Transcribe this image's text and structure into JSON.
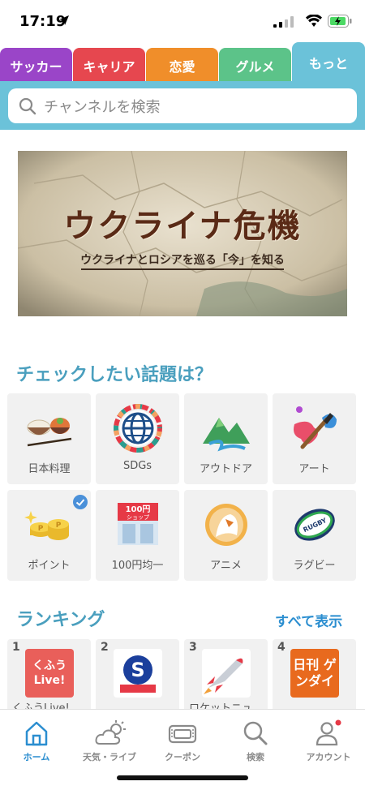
{
  "status_bar": {
    "time": "17:19"
  },
  "tabs": [
    {
      "label": "サッカー",
      "color": "#9a45c8"
    },
    {
      "label": "キャリア",
      "color": "#e6474f"
    },
    {
      "label": "恋愛",
      "color": "#f08e2a"
    },
    {
      "label": "グルメ",
      "color": "#5cc389"
    },
    {
      "label": "もっと",
      "color": "#6bc2d9"
    }
  ],
  "search": {
    "placeholder": "チャンネルを検索"
  },
  "banner": {
    "title": "ウクライナ危機",
    "subtitle": "ウクライナとロシアを巡る「今」を知る"
  },
  "topics": {
    "heading": "チェックしたい話題は？",
    "items": [
      {
        "label": "日本料理",
        "icon": "japanese-food-icon"
      },
      {
        "label": "SDGs",
        "icon": "sdgs-globe-icon"
      },
      {
        "label": "アウトドア",
        "icon": "mountain-icon"
      },
      {
        "label": "アート",
        "icon": "paint-brush-icon"
      },
      {
        "label": "ポイント",
        "icon": "coins-icon",
        "checked": true
      },
      {
        "label": "100円均一",
        "icon": "hundred-yen-shop-icon"
      },
      {
        "label": "アニメ",
        "icon": "anime-icon"
      },
      {
        "label": "ラグビー",
        "icon": "rugby-ball-icon"
      }
    ]
  },
  "ranking": {
    "heading": "ランキング",
    "see_all": "すべて表示",
    "items": [
      {
        "rank": "1",
        "name": "くふうLive!",
        "logo_text": "くふう Live!"
      },
      {
        "rank": "2",
        "name": "",
        "logo_text": "S"
      },
      {
        "rank": "3",
        "name": "ロケットニュ",
        "logo_text": ""
      },
      {
        "rank": "4",
        "name": "",
        "logo_text": "日刊 ゲンダイ"
      }
    ]
  },
  "bottom_nav": [
    {
      "label": "ホーム",
      "active": true
    },
    {
      "label": "天気・ライブ"
    },
    {
      "label": "クーポン"
    },
    {
      "label": "検索"
    },
    {
      "label": "アカウント",
      "badge": true
    }
  ],
  "colors": {
    "accent": "#2b8ed0",
    "section": "#4a9fbe",
    "search_band": "#6bc2d9"
  }
}
